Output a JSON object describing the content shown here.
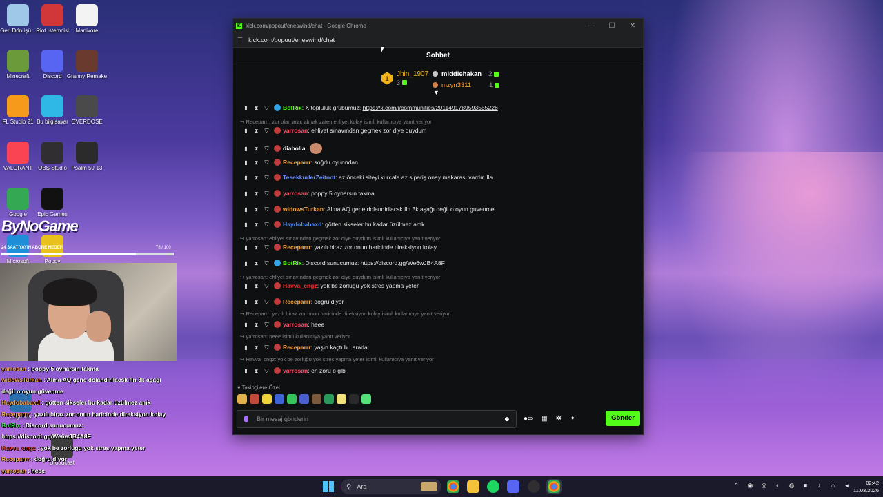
{
  "desktop": {
    "icons": [
      {
        "label": "Geri Dönüşü...",
        "icon": "recycle-bin-icon",
        "color": "#9fc8e8"
      },
      {
        "label": "Riot İstemcisi",
        "icon": "riot-icon",
        "color": "#d13639"
      },
      {
        "label": "Manivore",
        "icon": "manivore-icon",
        "color": "#f3f3f3"
      },
      {
        "label": "Minecraft",
        "icon": "minecraft-icon",
        "color": "#6a9a3a"
      },
      {
        "label": "Discord",
        "icon": "discord-icon",
        "color": "#5865f2"
      },
      {
        "label": "Granny Remake",
        "icon": "granny-icon",
        "color": "#6b3a2e"
      },
      {
        "label": "FL Studio 21",
        "icon": "fl-studio-icon",
        "color": "#f59a1b"
      },
      {
        "label": "Bu bilgisayar",
        "icon": "computer-icon",
        "color": "#2fb8e6"
      },
      {
        "label": "OVERDOSE",
        "icon": "overdose-icon",
        "color": "#4a4a4a"
      },
      {
        "label": "VALORANT",
        "icon": "valorant-icon",
        "color": "#fa4454"
      },
      {
        "label": "OBS Studio",
        "icon": "obs-icon",
        "color": "#302e31"
      },
      {
        "label": "Psalm 59-13",
        "icon": "psalm-icon",
        "color": "#2b2b2b"
      },
      {
        "label": "Google",
        "icon": "chrome-icon",
        "color": "#34a853"
      },
      {
        "label": "Epic Games",
        "icon": "epic-games-icon",
        "color": "#111111"
      },
      {
        "label": "Microsoft",
        "icon": "edge-icon",
        "color": "#1e8ed8"
      },
      {
        "label": "Poppy",
        "icon": "poppy-icon",
        "color": "#e8c21b"
      },
      {
        "label": "Legends",
        "icon": "league-icon",
        "color": "#2a6fb0"
      },
      {
        "label": "Broadcast",
        "icon": "broadcast-icon",
        "color": "#3c3c3c"
      }
    ]
  },
  "overlay": {
    "brand": "ByNoGame",
    "goal_label": "24 SAAT YAYIN ABONE HEDEFİ",
    "goal_count": "78 / 100",
    "goal_progress": 0.78,
    "chat": [
      {
        "user": "yarrosan",
        "sep": " : ",
        "text": "poppy 5 oynarsın takma",
        "color": "orange"
      },
      {
        "user": "widowsTurkan",
        "sep": " : ",
        "text": "Alma AQ gene dolandirilacsk fln 3k aşağı",
        "color": "orange"
      },
      {
        "user": "",
        "sep": "",
        "text": "değil o oyun güvenme",
        "color": "orange"
      },
      {
        "user": "Haydobabaxd",
        "sep": " : ",
        "text": "götten sikseler bu kadar üzülmez amk",
        "color": "orange"
      },
      {
        "user": "Receparrr",
        "sep": " : ",
        "text": "yazılı biraz zor onun haricinde direksiyon kolay",
        "color": "orange"
      },
      {
        "user": "BotRix",
        "sep": " : ",
        "text": "Discord sunucumuz:",
        "color": "green"
      },
      {
        "user": "",
        "sep": "",
        "text": "https://discord.gg/We6wJB4A8F",
        "color": "orange"
      },
      {
        "user": "Havva_cngz",
        "sep": " : ",
        "text": "yok be zorluğu yok stres yapma yeter",
        "color": "red"
      },
      {
        "user": "Receparrr",
        "sep": " : ",
        "text": "doğru diyor",
        "color": "orange"
      },
      {
        "user": "yarrosan",
        "sep": " : ",
        "text": "heee",
        "color": "orange"
      },
      {
        "user": "Receparrr",
        "sep": " : ",
        "text": "yaşın kaçtı bu arada",
        "color": "orange"
      },
      {
        "user": "yarrosan",
        "sep": " : ",
        "text": "en zoru o glb",
        "color": "orange"
      }
    ]
  },
  "window": {
    "title": "kick.com/popout/eneswind/chat - Google Chrome",
    "url": "kick.com/popout/eneswind/chat",
    "controls": {
      "minimize": "—",
      "maximize": "☐",
      "close": "✕"
    }
  },
  "chat": {
    "header": "Sohbet",
    "leaderboard": {
      "first": {
        "rank": "1",
        "name": "Jhin_1907",
        "count": "3"
      },
      "others": [
        {
          "name": "middlehakan",
          "count": "2"
        },
        {
          "name": "mzyn3311",
          "count": "1"
        }
      ]
    },
    "messages": [
      {
        "type": "msg",
        "user": "BotRix",
        "color": "#53fc18",
        "sep": ": ",
        "text": "X topluluk grubumuz: ",
        "link": "https://x.com/i/communities/2011491789593555226"
      },
      {
        "type": "reply",
        "text": "Receparrr: zor olan araç almak zaten ehliyet kolay isimli kullanıcıya yanıt veriyor"
      },
      {
        "type": "msg",
        "user": "yarrosan",
        "color": "#ff4d6a",
        "sep": ": ",
        "text": "ehliyet sınavından geçmek zor diye duydum",
        "link": ""
      },
      {
        "type": "msg",
        "user": "diabolia",
        "color": "#ffffff",
        "sep": ": ",
        "text": "",
        "link": ""
      },
      {
        "type": "msg",
        "user": "Receparrr",
        "color": "#f6a138",
        "sep": ": ",
        "text": "soğdu oyunndan",
        "link": ""
      },
      {
        "type": "msg",
        "user": "TesekkurlerZeitnot",
        "color": "#6c8cff",
        "sep": ": ",
        "text": "az önceki siteyi kurcala az sipariş onay makarası vardır illa",
        "link": ""
      },
      {
        "type": "msg",
        "user": "yarrosan",
        "color": "#ff4d6a",
        "sep": ": ",
        "text": "poppy 5 oynarsın takma",
        "link": ""
      },
      {
        "type": "msg",
        "user": "widowsTurkan",
        "color": "#f6a138",
        "sep": ": ",
        "text": "Alma AQ gene dolandirilacsk fln 3k aşağı değil o oyun guvenme",
        "link": ""
      },
      {
        "type": "msg",
        "user": "Haydobabaxd",
        "color": "#4f8bff",
        "sep": ": ",
        "text": "götten sikseler bu kadar üzülmez amk",
        "link": ""
      },
      {
        "type": "reply",
        "text": "yarrosan: ehliyet sınavından geçmek zor diye duydum isimli kullanıcıya yanıt veriyor"
      },
      {
        "type": "msg",
        "user": "Receparrr",
        "color": "#f6a138",
        "sep": ": ",
        "text": "yazılı biraz zor onun haricinde direksiyon kolay",
        "link": ""
      },
      {
        "type": "msg",
        "user": "BotRix",
        "color": "#53fc18",
        "sep": ": ",
        "text": "Discord sunucumuz: ",
        "link": "https://discord.gg/We6wJB4A8F"
      },
      {
        "type": "reply",
        "text": "yarrosan: ehliyet sınavından geçmek zor diye duydum isimli kullanıcıya yanıt veriyor"
      },
      {
        "type": "msg",
        "user": "Havva_cngz",
        "color": "#ff2a2a",
        "sep": ": ",
        "text": "yok be zorluğu yok stres yapma yeter",
        "link": ""
      },
      {
        "type": "msg",
        "user": "Receparrr",
        "color": "#f6a138",
        "sep": ": ",
        "text": "doğru diyor",
        "link": ""
      },
      {
        "type": "reply",
        "text": "Receparrr: yazılı biraz zor onun haricinde direksiyon kolay isimli kullanıcıya yanıt veriyor"
      },
      {
        "type": "msg",
        "user": "yarrosan",
        "color": "#ff4d6a",
        "sep": ": ",
        "text": "heee",
        "link": ""
      },
      {
        "type": "reply",
        "text": "yarrosan: heee isimli kullanıcıya yanıt veriyor"
      },
      {
        "type": "msg",
        "user": "Receparrr",
        "color": "#f6a138",
        "sep": ": ",
        "text": "yaşın kaçtı bu arada",
        "link": ""
      },
      {
        "type": "reply",
        "text": "Havva_cngz: yok be zorluğu yok stres yapma yeter isimli kullanıcıya yanıt veriyor"
      },
      {
        "type": "msg",
        "user": "yarrosan",
        "color": "#ff4d6a",
        "sep": ": ",
        "text": "en zoru o glb",
        "link": ""
      }
    ],
    "emote_label": "Takipçilere Özel",
    "input_placeholder": "Bir mesaj gönderin",
    "send_label": "Gönder"
  },
  "taskbar": {
    "search_label": "Ara",
    "apps": [
      "chrome-icon",
      "file-explorer-icon",
      "spotify-icon",
      "discord-icon",
      "obs-icon",
      "chrome-active-icon"
    ],
    "time": "02:42",
    "date": "11.03.2026"
  }
}
